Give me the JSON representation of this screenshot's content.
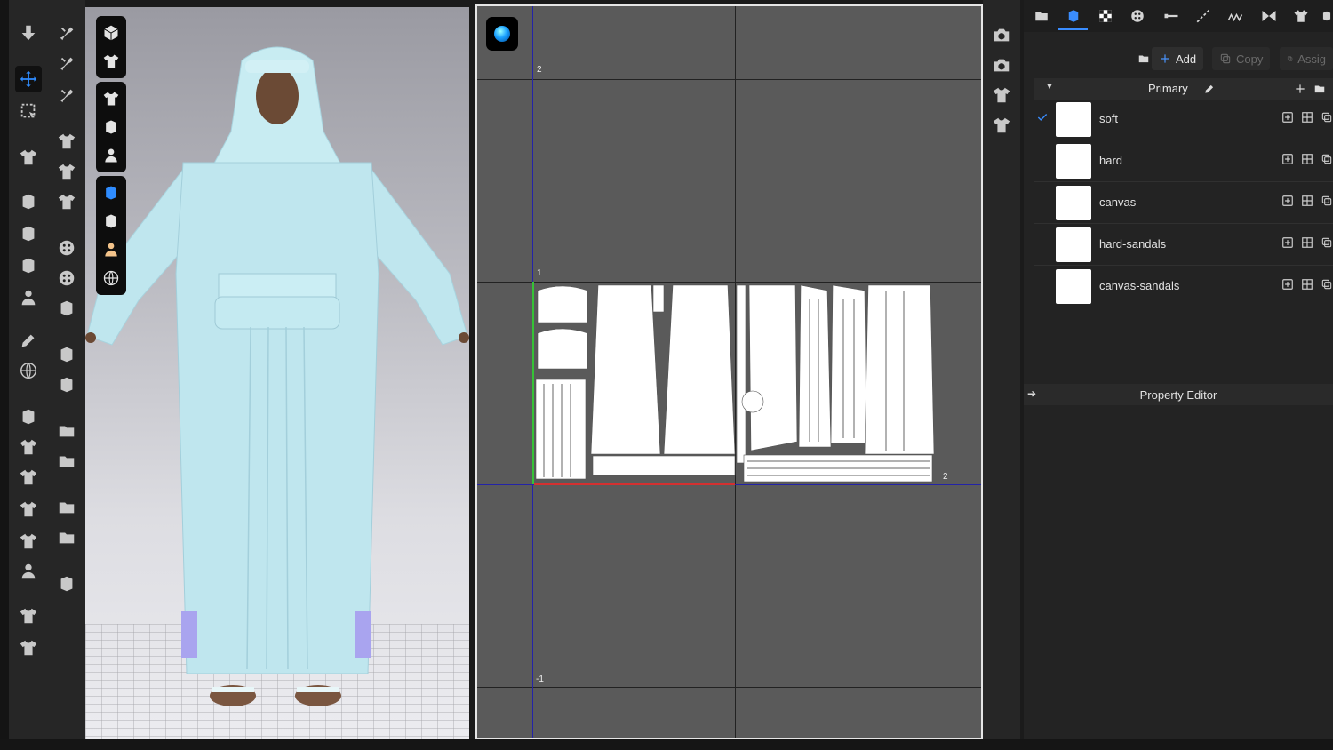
{
  "window": {
    "title": ""
  },
  "left_toolbar": {
    "col1_icons": [
      "move-down-icon",
      "transform-move-icon",
      "select-region-icon",
      "fold-icon",
      "arrange-icon",
      "seam-icon",
      "tack-icon",
      "avatar-pose-icon",
      "pen-icon",
      "rotate-icon",
      "cut-icon",
      "piece-icon",
      "garment-icon",
      "fit-icon",
      "hanger-icon",
      "avatar-icon",
      "zipper-icon",
      "button-icon"
    ],
    "col2_icons": [
      "pin-icon",
      "pin-multi-icon",
      "pin-fold-icon",
      "brush-icon",
      "texture-icon",
      "layer-icon",
      "point-icon",
      "cog-icon",
      "lock-icon",
      "trim-icon",
      "measure-icon",
      "piece-add-icon",
      "rect-icon",
      "piece-edit-icon",
      "rect2-icon",
      "anchor-icon"
    ]
  },
  "viewport_toolbar": {
    "items": [
      "cube-icon",
      "shirt-solid-icon",
      "shirt-icon",
      "fabric-icon",
      "avatar-icon",
      "texture-blue-icon",
      "eraser-icon",
      "skin-icon",
      "globe-icon"
    ]
  },
  "viewport2d": {
    "axis_labels": {
      "top": "2",
      "mid": "1",
      "right": "2",
      "bottom": "-1"
    }
  },
  "right_mini_toolbar": {
    "items": [
      "camera-snapshot-icon",
      "camera-icon",
      "garment-front-icon",
      "garment-back-icon"
    ]
  },
  "panel": {
    "tabs": [
      "library-icon",
      "fabric-icon",
      "checker-icon",
      "button-icon",
      "line-icon",
      "topstitch-icon",
      "zigzag-icon",
      "bow-icon",
      "jacket-icon",
      "more-icon"
    ],
    "actions": {
      "add": "Add",
      "copy": "Copy",
      "assign": "Assig"
    },
    "group": {
      "name": "Primary"
    },
    "materials": [
      {
        "name": "soft",
        "checked": true
      },
      {
        "name": "hard",
        "checked": false
      },
      {
        "name": "canvas",
        "checked": false
      },
      {
        "name": "hard-sandals",
        "checked": false
      },
      {
        "name": "canvas-sandals",
        "checked": false
      }
    ],
    "property_editor": {
      "title": "Property Editor"
    }
  },
  "status_bar": {
    "text": ""
  },
  "colors": {
    "accent": "#3a8dff",
    "garment": "#bfe6ee",
    "panel_bg": "#232323",
    "viewport2d_bg": "#5a5a5a"
  }
}
